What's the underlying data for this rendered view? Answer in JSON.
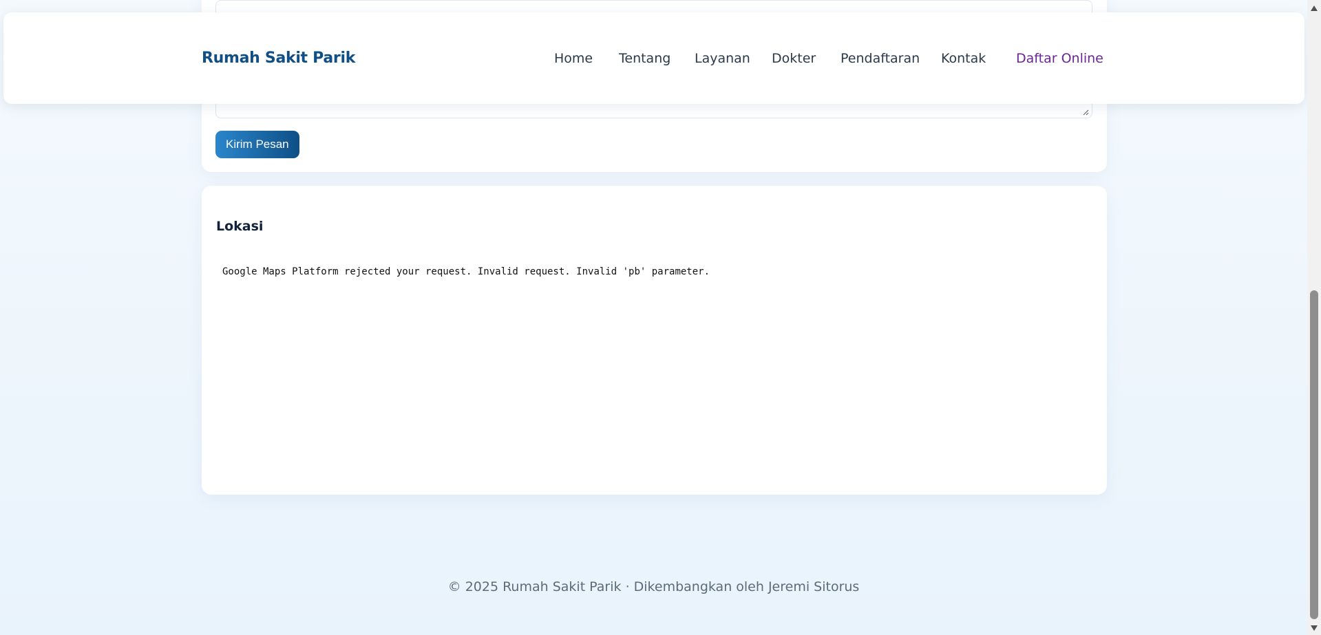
{
  "header": {
    "brand": "Rumah Sakit Parik",
    "nav": {
      "home": "Home",
      "tentang": "Tentang",
      "layanan": "Layanan",
      "dokter": "Dokter",
      "pendaftaran": "Pendaftaran",
      "kontak": "Kontak",
      "daftar_online": "Daftar Online"
    }
  },
  "contact_form": {
    "send_button": "Kirim Pesan"
  },
  "location": {
    "title": "Lokasi",
    "map_error": "Google Maps Platform rejected your request. Invalid request. Invalid 'pb' parameter."
  },
  "footer": {
    "text": "© 2025 Rumah Sakit Parik · Dikembangkan oleh Jeremi Sitorus"
  },
  "colors": {
    "brand": "#0f4f86",
    "cta": "#6b2596",
    "button_start": "#2a86cb",
    "button_end": "#0f4f86"
  }
}
